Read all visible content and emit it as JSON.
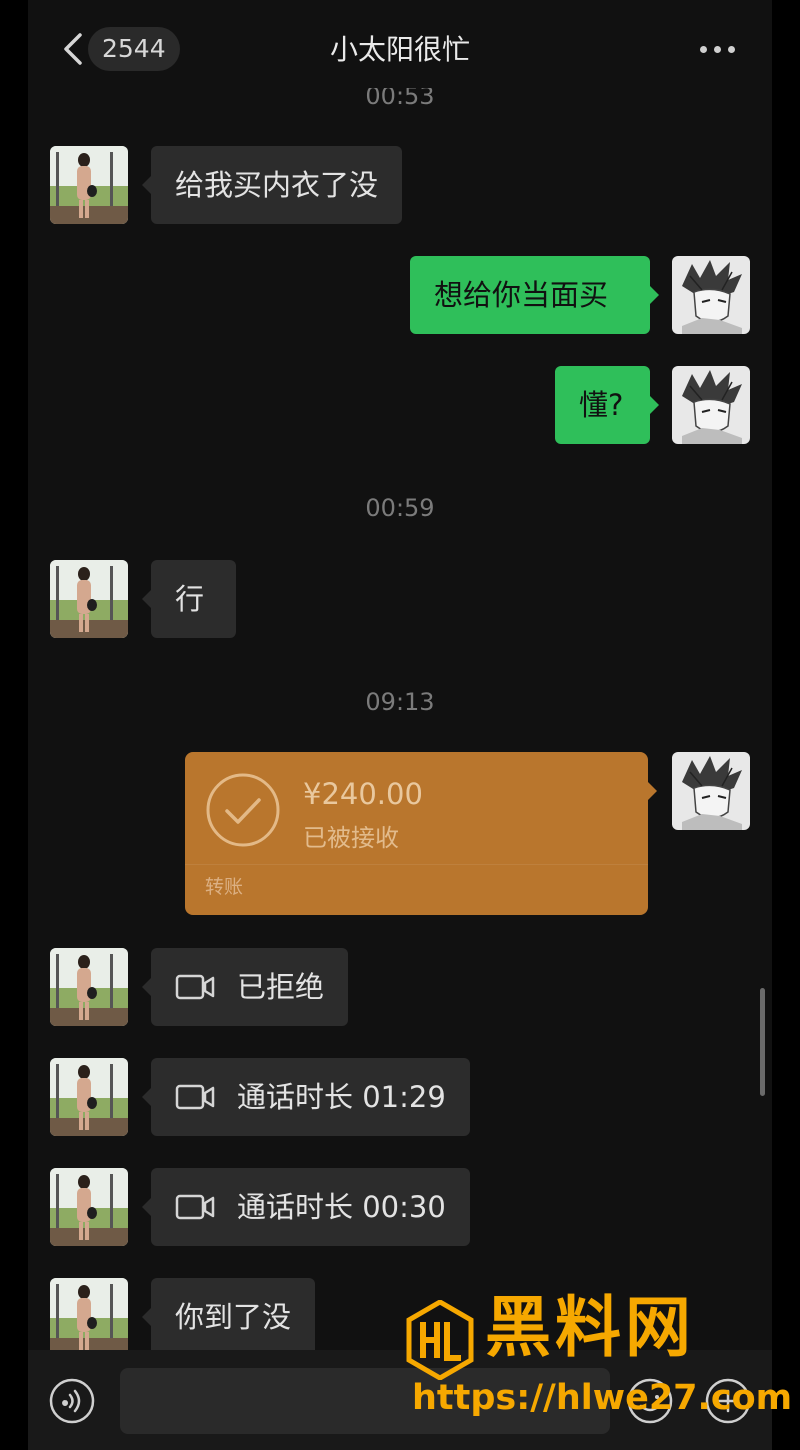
{
  "header": {
    "unread_count": "2544",
    "title": "小太阳很忙"
  },
  "timestamps": {
    "t1": "00:53",
    "t2": "00:59",
    "t3": "09:13"
  },
  "messages": {
    "m1": "给我买内衣了没",
    "m2": "想给你当面买",
    "m3": "懂?",
    "m4": "行",
    "m5": "已拒绝",
    "m6": "通话时长 01:29",
    "m7": "通话时长 00:30",
    "m8": "你到了没"
  },
  "transfer": {
    "amount": "¥240.00",
    "status": "已被接收",
    "label": "转账"
  },
  "watermark": {
    "text": "黑料网",
    "url": "https://hlwe27.com"
  },
  "colors": {
    "outgoing_bubble": "#2fbf5a",
    "incoming_bubble": "#2c2c2c",
    "transfer_card": "#b9762d",
    "watermark": "#f6a800"
  },
  "icons": [
    "back-icon",
    "more-icon",
    "video-call-icon",
    "check-circle-icon",
    "voice-icon",
    "emoji-icon",
    "plus-icon"
  ]
}
